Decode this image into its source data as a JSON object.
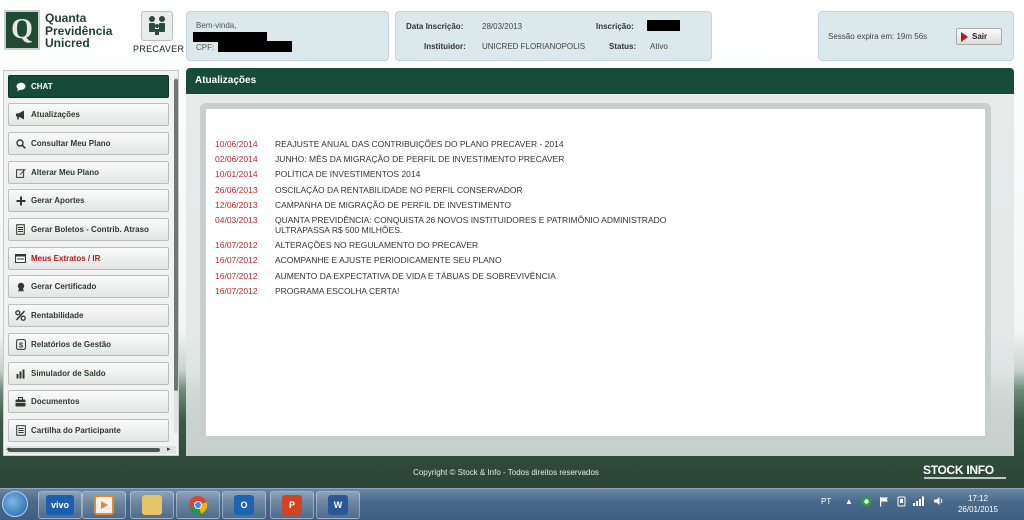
{
  "header": {
    "brand_line1": "Quanta",
    "brand_line2": "Previdência",
    "brand_line3": "Unicred",
    "logo_letter": "Q",
    "precaver_label": "PRECAVER",
    "welcome_label": "Bem-vinda,",
    "cpf_label": "CPF:",
    "data_inscricao_label": "Data Inscrição:",
    "data_inscricao_value": "28/03/2013",
    "inscricao_label": "Inscrição:",
    "instituidor_label": "Instituidor:",
    "instituidor_value": "UNICRED FLORIANOPOLIS",
    "status_label": "Status:",
    "status_value": "Ativo",
    "session_text": "Sessão expira em: 19m 56s",
    "logout_label": "Sair"
  },
  "sidebar": {
    "items": [
      {
        "label": "CHAT",
        "icon": "chat-bubble-icon"
      },
      {
        "label": "Atualizações",
        "icon": "megaphone-icon"
      },
      {
        "label": "Consultar Meu Plano",
        "icon": "search-icon"
      },
      {
        "label": "Alterar Meu Plano",
        "icon": "edit-icon"
      },
      {
        "label": "Gerar Aportes",
        "icon": "plus-icon"
      },
      {
        "label": "Gerar Boletos - Contrib. Atraso",
        "icon": "document-icon"
      },
      {
        "label": "Meus Extratos / IR",
        "icon": "statement-icon"
      },
      {
        "label": "Gerar Certificado",
        "icon": "certificate-icon"
      },
      {
        "label": "Rentabilidade",
        "icon": "percent-icon"
      },
      {
        "label": "Relatórios de Gestão",
        "icon": "money-icon"
      },
      {
        "label": "Simulador de Saldo",
        "icon": "bar-chart-icon"
      },
      {
        "label": "Documentos",
        "icon": "briefcase-icon"
      },
      {
        "label": "Cartilha do Participante",
        "icon": "booklet-icon"
      }
    ],
    "active_index": 6
  },
  "main": {
    "title": "Atualizações",
    "news": [
      {
        "date": "10/06/2014",
        "title": "REAJUSTE ANUAL DAS CONTRIBUIÇÕES DO PLANO PRECAVER - 2014"
      },
      {
        "date": "02/06/2014",
        "title": "JUNHO: MÊS DA MIGRAÇÃO DE PERFIL DE INVESTIMENTO PRECAVER"
      },
      {
        "date": "10/01/2014",
        "title": "POLÍTICA DE INVESTIMENTOS 2014"
      },
      {
        "date": "26/06/2013",
        "title": "OSCILAÇÃO DA RENTABILIDADE NO PERFIL CONSERVADOR"
      },
      {
        "date": "12/06/2013",
        "title": "CAMPANHA DE MIGRAÇÃO DE PERFIL DE INVESTIMENTO"
      },
      {
        "date": "04/03/2013",
        "title": "QUANTA PREVIDÊNCIA: CONQUISTA 26 NOVOS INSTITUIDORES E PATRIMÔNIO ADMINISTRADO ULTRAPASSA R$ 500 MILHÕES."
      },
      {
        "date": "16/07/2012",
        "title": "ALTERAÇÕES NO REGULAMENTO DO PRECAVER"
      },
      {
        "date": "16/07/2012",
        "title": "ACOMPANHE E AJUSTE PERIODICAMENTE SEU PLANO"
      },
      {
        "date": "16/07/2012",
        "title": "AUMENTO DA EXPECTATIVA DE VIDA E TÁBUAS DE SOBREVIVÊNCIA"
      },
      {
        "date": "16/07/2012",
        "title": "PROGRAMA ESCOLHA CERTA!"
      }
    ]
  },
  "footer": {
    "copyright": "Copyright © Stock & Info - Todos direitos reservados",
    "logo_text": "STOCK INFO"
  },
  "taskbar": {
    "vivo_label": "vivo",
    "language": "PT",
    "time": "17:12",
    "date": "26/01/2015"
  },
  "colors": {
    "brand_green": "#164c39",
    "date_red": "#c0282d",
    "logout_red": "#c0141c"
  }
}
